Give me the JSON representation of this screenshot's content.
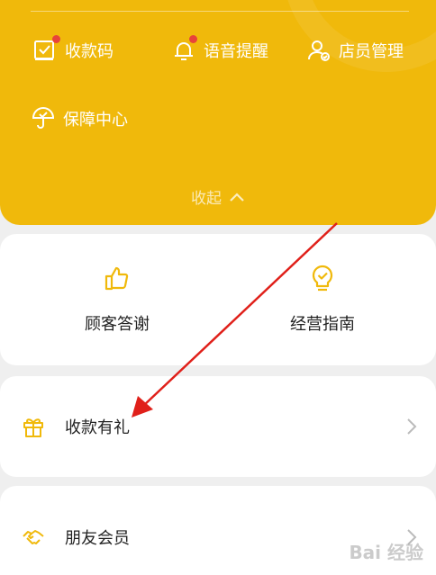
{
  "menu": {
    "items": [
      {
        "label": "收款码",
        "icon": "qr-code-icon",
        "badge": true
      },
      {
        "label": "语音提醒",
        "icon": "bell-icon",
        "badge": true
      },
      {
        "label": "店员管理",
        "icon": "staff-icon",
        "badge": false
      },
      {
        "label": "保障中心",
        "icon": "umbrella-icon",
        "badge": false
      }
    ],
    "collapse_label": "收起"
  },
  "tools": [
    {
      "label": "顾客答谢",
      "icon": "thumbs-up-icon"
    },
    {
      "label": "经营指南",
      "icon": "lightbulb-check-icon"
    }
  ],
  "rows": [
    {
      "label": "收款有礼",
      "icon": "gift-icon"
    },
    {
      "label": "朋友会员",
      "icon": "handshake-icon"
    }
  ],
  "watermark": "Bai 经验",
  "colors": {
    "brand_yellow": "#f0b90b",
    "icon_yellow": "#f0b90b",
    "badge_red": "#e8433a",
    "annotation_red": "#e0201a",
    "background": "#efefef"
  }
}
